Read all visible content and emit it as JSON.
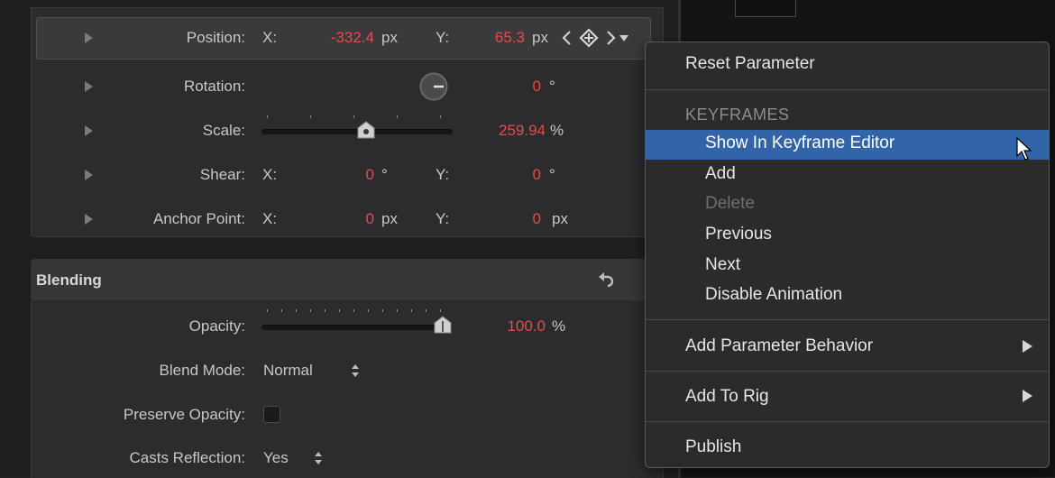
{
  "transform": {
    "position": {
      "label": "Position:",
      "x_label": "X:",
      "x_value": "-332.4",
      "x_unit": "px",
      "y_label": "Y:",
      "y_value": "65.3",
      "y_unit": "px"
    },
    "rotation": {
      "label": "Rotation:",
      "value": "0",
      "unit": "°"
    },
    "scale": {
      "label": "Scale:",
      "value": "259.94",
      "unit": "%",
      "slider_level": 0.55
    },
    "shear": {
      "label": "Shear:",
      "x_label": "X:",
      "x_value": "0",
      "x_unit": "°",
      "y_label": "Y:",
      "y_value": "0",
      "y_unit": "°"
    },
    "anchor_point": {
      "label": "Anchor Point:",
      "x_label": "X:",
      "x_value": "0",
      "x_unit": "px",
      "y_label": "Y:",
      "y_value": "0",
      "y_unit": "px"
    }
  },
  "blending": {
    "title": "Blending",
    "opacity": {
      "label": "Opacity:",
      "value": "100.0",
      "unit": "%",
      "slider_level": 1.0
    },
    "blend_mode": {
      "label": "Blend Mode:",
      "value": "Normal"
    },
    "preserve_opacity": {
      "label": "Preserve Opacity:",
      "checked": false
    },
    "casts_reflection": {
      "label": "Casts Reflection:",
      "value": "Yes"
    }
  },
  "context_menu": {
    "reset": "Reset Parameter",
    "keyframes_header": "KEYFRAMES",
    "show_in_keyframe_editor": "Show In Keyframe Editor",
    "add": "Add",
    "delete": "Delete",
    "previous": "Previous",
    "next": "Next",
    "disable_animation": "Disable Animation",
    "add_parameter_behavior": "Add Parameter Behavior",
    "add_to_rig": "Add To Rig",
    "publish": "Publish"
  },
  "colors": {
    "value_red": "#e64b4b",
    "selection_blue": "#3264a8"
  }
}
